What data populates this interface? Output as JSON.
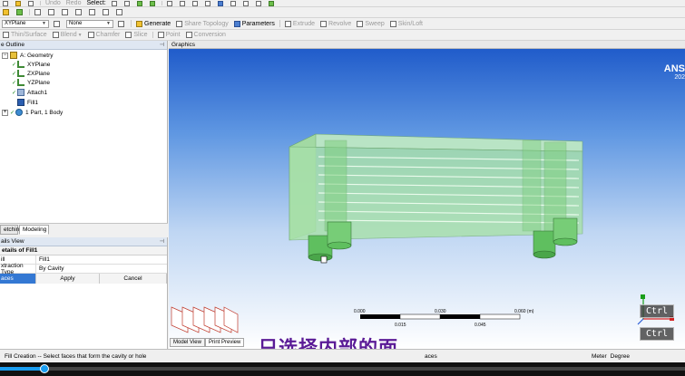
{
  "toolbar1": {
    "undo": "Undo",
    "redo": "Redo",
    "select": "Select:"
  },
  "toolbar2": {
    "plane": "XYPlane",
    "sketch": "None",
    "generate": "Generate",
    "share_topology": "Share Topology",
    "parameters": "Parameters",
    "extrude": "Extrude",
    "revolve": "Revolve",
    "sweep": "Sweep",
    "skin_loft": "Skin/Loft"
  },
  "toolbar3": {
    "thin_surface": "Thin/Surface",
    "blend": "Blend",
    "chamfer": "Chamfer",
    "slice": "Slice",
    "point": "Point",
    "conversion": "Conversion"
  },
  "tree": {
    "header": "e Outline",
    "items": [
      {
        "label": "A: Geometry"
      },
      {
        "label": "XYPlane"
      },
      {
        "label": "ZXPlane"
      },
      {
        "label": "YZPlane"
      },
      {
        "label": "Attach1"
      },
      {
        "label": "Fill1"
      },
      {
        "label": "1 Part, 1 Body"
      }
    ]
  },
  "tabs": {
    "sketching": "etching",
    "modeling": "Modeling"
  },
  "details": {
    "header": "ails View",
    "title": "etails of Fill1",
    "rows": [
      {
        "key": "ill",
        "value": "Fill1"
      },
      {
        "key": "xtraction Type",
        "value": "By Cavity"
      }
    ],
    "faces": "aces",
    "apply": "Apply",
    "cancel": "Cancel"
  },
  "graphics": {
    "header": "Graphics",
    "brand": "ANS",
    "brand_year": "202",
    "scale": {
      "top_labels": [
        "0.000",
        "0.030",
        "0.060 (m)"
      ],
      "bottom_labels": [
        "0.015",
        "0.045"
      ]
    },
    "view_tabs": [
      "Model View",
      "Print Preview"
    ]
  },
  "overlays": {
    "subtitle": "只选择内部的面",
    "key1": "Ctrl",
    "key2": "Ctrl"
  },
  "status": {
    "message": "Fill Creation -- Select faces that form the cavity or hole",
    "selection": "aces",
    "units": [
      "Meter",
      "Degree"
    ]
  },
  "video": {
    "progress": 0.065
  },
  "colors": {
    "accent": "#3478d3",
    "subtitle": "#5a1b96",
    "model_green": "#8fd68f",
    "seek": "#1a9df0"
  }
}
